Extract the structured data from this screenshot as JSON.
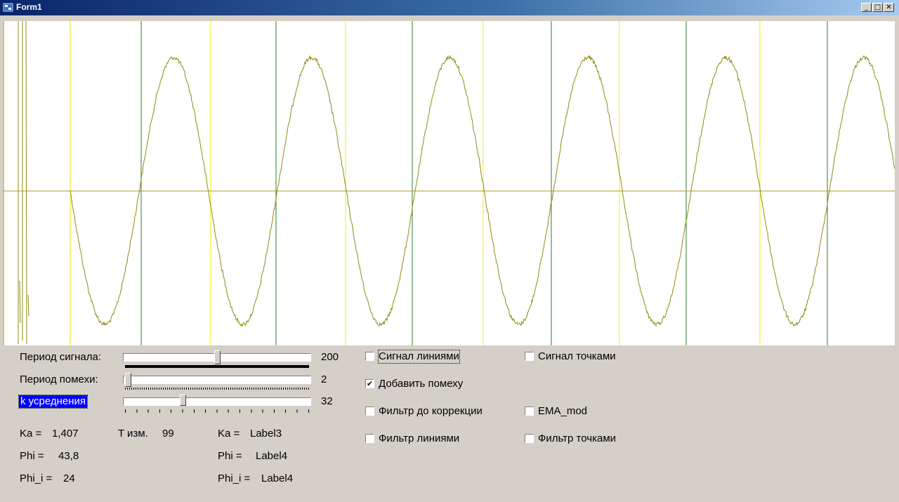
{
  "window": {
    "title": "Form1",
    "minimize_glyph": "_",
    "maximize_glyph": "□",
    "close_glyph": "✕",
    "icon": "app-form-icon"
  },
  "plot": {
    "zero_axis_color": "#a89a30",
    "signal_color": "#8c8c10",
    "green_gridline_color": "#2e7d32",
    "yellow_gridline_color": "#f0f000"
  },
  "controls": {
    "signal_period": {
      "label": "Период сигнала:",
      "value": "200",
      "position": 0.5
    },
    "noise_period": {
      "label": "Период помехи:",
      "value": "2",
      "position": 0.02
    },
    "averaging": {
      "label": "k усреднения",
      "value": "32",
      "position": 0.32
    }
  },
  "readouts": {
    "ka_label": "Ka =",
    "ka_value": "1,407",
    "t_label": "T изм.",
    "t_value": "99",
    "phi_label": "Phi =",
    "phi_value": "43,8",
    "phi_i_label": "Phi_i =",
    "phi_i_value": "24",
    "ka2_label": "Ka =",
    "ka2_value": "Label3",
    "phi2_label": "Phi =",
    "phi2_value": "Label4",
    "phi_i2_label": "Phi_i =",
    "phi_i2_value": "Label4"
  },
  "checkboxes": {
    "signal_lines": {
      "label": "Сигнал линиями",
      "checked": false
    },
    "signal_points": {
      "label": "Сигнал точками",
      "checked": false
    },
    "add_noise": {
      "label": "Добавить помеху",
      "checked": true
    },
    "filter_before": {
      "label": "Фильтр до коррекции",
      "checked": false
    },
    "ema_mod": {
      "label": "EMA_mod",
      "checked": false
    },
    "filter_lines": {
      "label": "Фильтр линиями",
      "checked": false
    },
    "filter_points": {
      "label": "Фильтр точками",
      "checked": false
    }
  }
}
